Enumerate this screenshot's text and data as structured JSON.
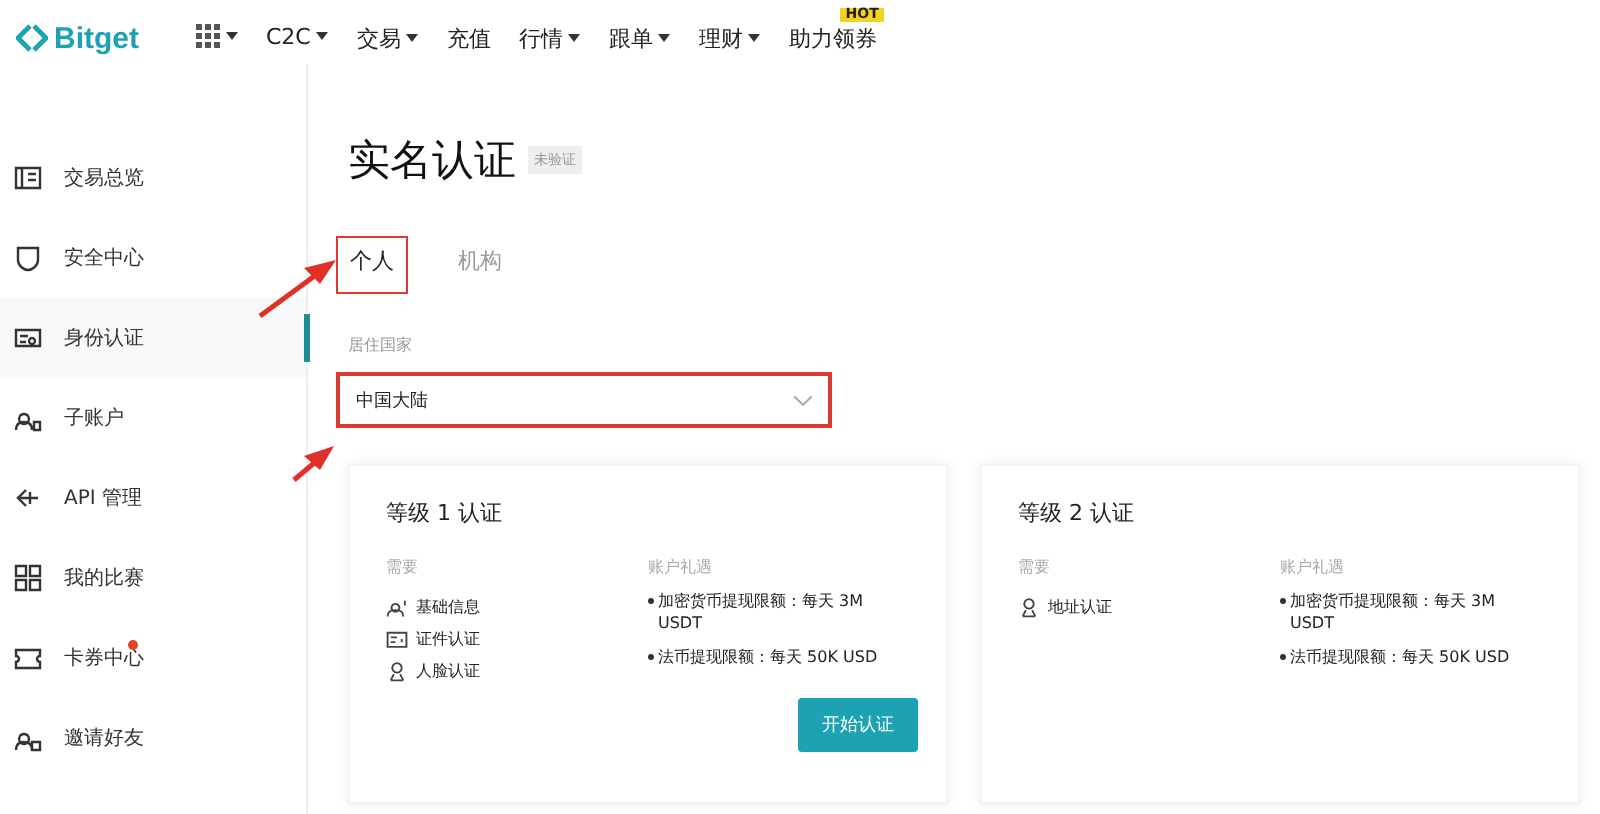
{
  "header": {
    "logo": "Bitget",
    "nav": [
      {
        "kind": "grid",
        "dropdown": true
      },
      {
        "kind": "text",
        "label": "C2C",
        "dropdown": true
      },
      {
        "kind": "text",
        "label": "交易",
        "dropdown": true
      },
      {
        "kind": "text",
        "label": "充值",
        "dropdown": false
      },
      {
        "kind": "text",
        "label": "行情",
        "dropdown": true
      },
      {
        "kind": "text",
        "label": "跟单",
        "dropdown": true
      },
      {
        "kind": "text",
        "label": "理财",
        "dropdown": true
      },
      {
        "kind": "text",
        "label": "助力领券",
        "dropdown": false,
        "badge": "HOT"
      }
    ]
  },
  "sidebar": {
    "items": [
      {
        "label": "交易总览",
        "selected": false,
        "dot": false
      },
      {
        "label": "安全中心",
        "selected": false,
        "dot": false
      },
      {
        "label": "身份认证",
        "selected": true,
        "dot": false
      },
      {
        "label": "子账户",
        "selected": false,
        "dot": false
      },
      {
        "label": "API 管理",
        "selected": false,
        "dot": false
      },
      {
        "label": "我的比赛",
        "selected": false,
        "dot": false
      },
      {
        "label": "卡券中心",
        "selected": false,
        "dot": true
      },
      {
        "label": "邀请好友",
        "selected": false,
        "dot": false
      }
    ]
  },
  "page": {
    "title": "实名认证",
    "status": "未验证",
    "tabs": [
      {
        "label": "个人",
        "selected": true,
        "highlighted": true
      },
      {
        "label": "机构",
        "selected": false,
        "highlighted": false
      }
    ],
    "country": {
      "label": "居住国家",
      "value": "中国大陆",
      "highlighted": true
    },
    "levels": [
      {
        "title": "等级 1 认证",
        "requirements_label": "需要",
        "requirements": [
          "基础信息",
          "证件认证",
          "人脸认证"
        ],
        "benefits_label": "账户礼遇",
        "benefits": [
          "加密货币提现限额：每天 3M USDT",
          "法币提现限额：每天 50K USD"
        ],
        "button": "开始认证"
      },
      {
        "title": "等级 2 认证",
        "requirements_label": "需要",
        "requirements": [
          "地址认证"
        ],
        "benefits_label": "账户礼遇",
        "benefits": [
          "加密货币提现限额：每天 3M USDT",
          "法币提现限额：每天 50K USD"
        ]
      }
    ]
  }
}
